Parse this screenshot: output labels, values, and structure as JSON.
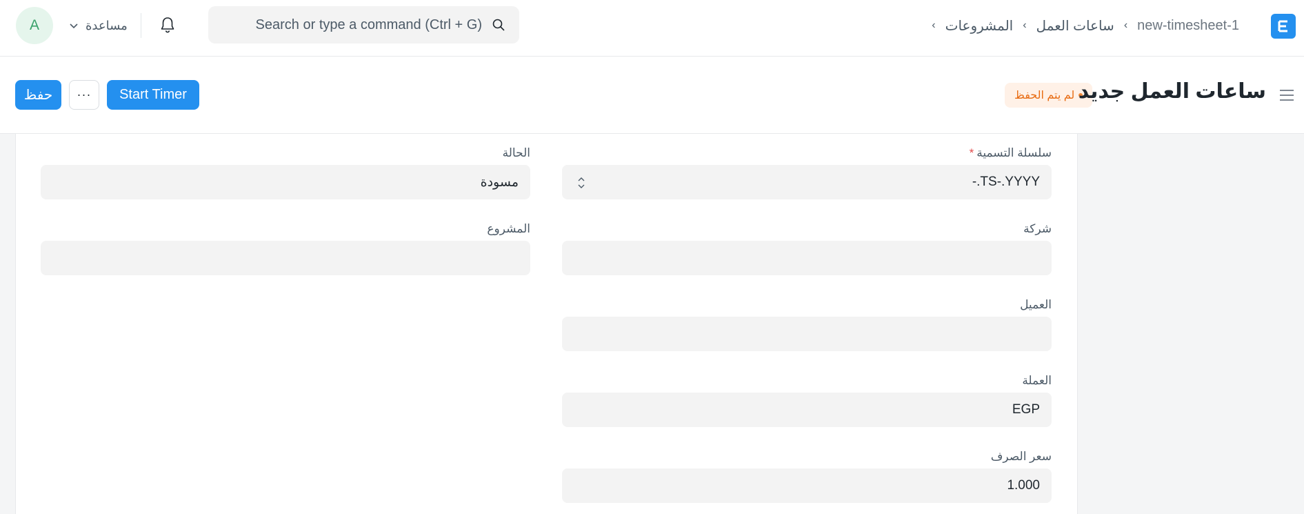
{
  "navbar": {
    "avatar_initial": "A",
    "help_label": "مساعدة",
    "search_placeholder": "Search or type a command (Ctrl + G)",
    "breadcrumb": [
      "المشروعات",
      "ساعات العمل",
      "new-timesheet-1"
    ],
    "logo_letter": "E",
    "accent_color": "#2490ef"
  },
  "page_header": {
    "title": "ساعات العمل جديد",
    "status_badge": "لم يتم الحفظ",
    "save_label": "حفظ",
    "start_timer_label": "Start Timer",
    "more_label": "···"
  },
  "form": {
    "naming_series": {
      "label": "سلسلة التسمية",
      "required_mark": "*",
      "value": "-.TS-.YYYY"
    },
    "status": {
      "label": "الحالة",
      "value": "مسودة"
    },
    "company": {
      "label": "شركة",
      "value": ""
    },
    "project": {
      "label": "المشروع",
      "value": ""
    },
    "customer": {
      "label": "العميل",
      "value": ""
    },
    "currency": {
      "label": "العملة",
      "value": "EGP"
    },
    "exchange_rate": {
      "label": "سعر الصرف",
      "value": "1.000"
    }
  }
}
